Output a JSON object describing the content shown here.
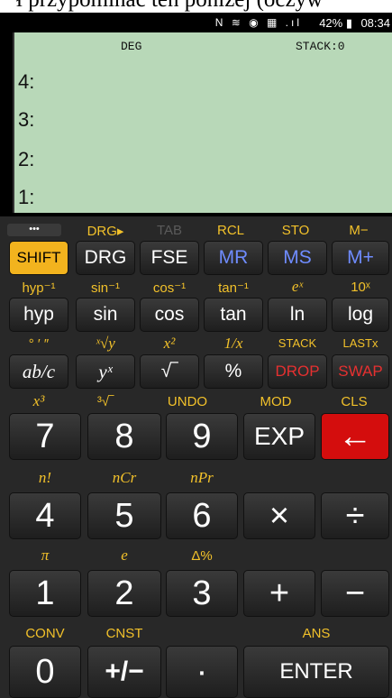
{
  "caption": "ł przypominać ten poniżej (oczyw",
  "status": {
    "icons": "N ≋ ◉ ▦ .ıl",
    "battery": "42% ▮",
    "time": "08:34"
  },
  "display": {
    "mode": "DEG",
    "stack": "STACK:0",
    "rows": [
      "4:",
      "3:",
      "2:",
      "1:"
    ]
  },
  "menu_dots": "•••",
  "shift_labels": {
    "row1": [
      "DRG▸",
      "TAB",
      "RCL",
      "STO",
      "M−"
    ],
    "row2": [
      "hyp⁻¹",
      "sin⁻¹",
      "cos⁻¹",
      "tan⁻¹",
      "eˣ",
      "10ˣ"
    ],
    "row3": [
      "° ′ ″",
      "ˣ√y",
      "x²",
      "1/x",
      "STACK",
      "LASTx"
    ],
    "row4": [
      "x³",
      "³√‾",
      "UNDO",
      "MOD",
      "CLS"
    ],
    "row5": [
      "n!",
      "nCr",
      "nPr"
    ],
    "row6": [
      "π",
      "e",
      "Δ%"
    ],
    "row7": [
      "CONV",
      "CNST",
      "ANS"
    ]
  },
  "keys": {
    "row1": [
      "SHIFT",
      "DRG",
      "FSE",
      "MR",
      "MS",
      "M+"
    ],
    "row2": [
      "hyp",
      "sin",
      "cos",
      "tan",
      "ln",
      "log"
    ],
    "row3": [
      "ab/c",
      "yˣ",
      "√‾",
      "%",
      "DROP",
      "SWAP"
    ],
    "row4": [
      "7",
      "8",
      "9",
      "EXP",
      "←"
    ],
    "row5": [
      "4",
      "5",
      "6",
      "×",
      "÷"
    ],
    "row6": [
      "1",
      "2",
      "3",
      "+",
      "−"
    ],
    "row7": [
      "0",
      "+/−",
      "·",
      "ENTER"
    ]
  },
  "colors": {
    "display_bg": "#b8d8b8",
    "shift_key": "#f2b31e",
    "accent_yellow": "#f2c12a",
    "memory_blue": "#6f8cff",
    "danger_red": "#e63030",
    "backspace_bg": "#d40d0d"
  }
}
